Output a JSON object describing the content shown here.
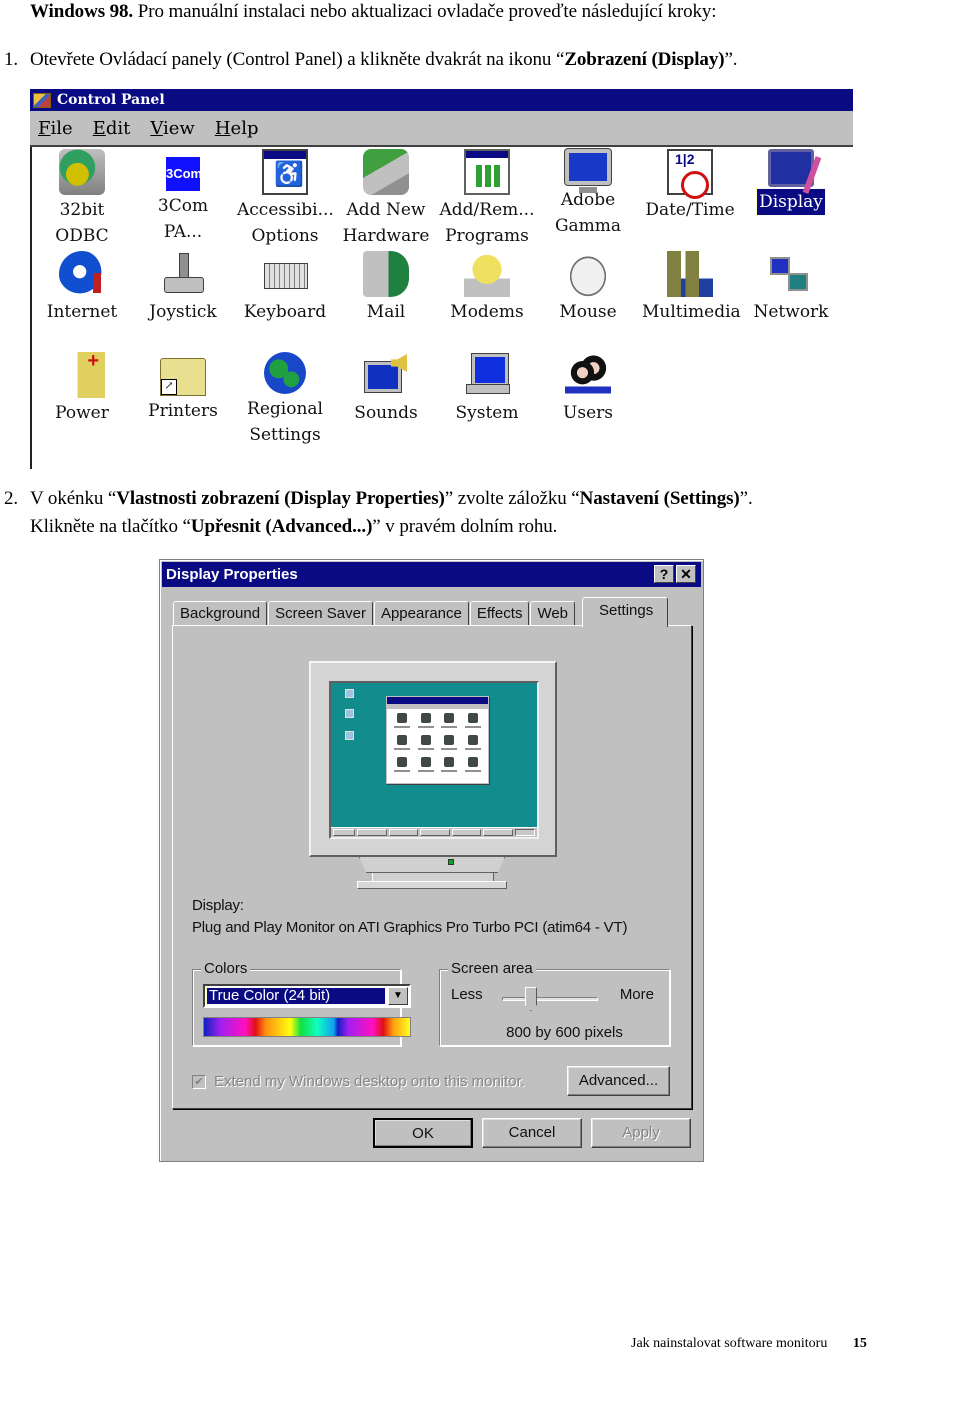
{
  "document": {
    "intro": {
      "bold": "Windows 98.",
      "text": " Pro manuální instalaci nebo aktualizaci ovladače proveďte následující kroky:"
    },
    "step1": {
      "number": "1.",
      "text_before": "Otevřete Ovládací panely (Control Panel) a klikněte dvakrát na ikonu “",
      "bold": "Zobrazení (Display)",
      "text_after": "”."
    },
    "step2": {
      "number": "2.",
      "line1_a": "V okénku “",
      "line1_bold1": "Vlastnosti zobrazení (Display Properties)",
      "line1_b": "” zvolte záložku “",
      "line1_bold2": "Nastavení (Settings)",
      "line1_c": "”.",
      "line2_a": "Klikněte na tlačítko “",
      "line2_bold": "Upřesnit (Advanced...)",
      "line2_b": "” v pravém dolním rohu."
    },
    "footer": {
      "title": "Jak nainstalovat software monitoru",
      "page": "15"
    }
  },
  "control_panel": {
    "title": "Control Panel",
    "menu": [
      {
        "accel": "F",
        "rest": "ile"
      },
      {
        "accel": "E",
        "rest": "dit"
      },
      {
        "accel": "V",
        "rest": "iew"
      },
      {
        "accel": "H",
        "rest": "elp"
      }
    ],
    "items": [
      {
        "line1": "32bit",
        "line2": "ODBC",
        "icon": "odbc-icon"
      },
      {
        "line1": "3Com",
        "line2": "PA...",
        "icon": "3com-icon",
        "icon_text": "3Com"
      },
      {
        "line1": "Accessibi...",
        "line2": "Options",
        "icon": "accessibility-icon"
      },
      {
        "line1": "Add New",
        "line2": "Hardware",
        "icon": "add-hardware-icon"
      },
      {
        "line1": "Add/Rem...",
        "line2": "Programs",
        "icon": "add-remove-programs-icon"
      },
      {
        "line1": "Adobe",
        "line2": "Gamma",
        "icon": "adobe-gamma-icon"
      },
      {
        "line1": "Date/Time",
        "line2": "",
        "icon": "date-time-icon"
      },
      {
        "line1": "Display",
        "line2": "",
        "icon": "display-icon",
        "selected": true
      },
      {
        "line1": "Internet",
        "line2": "",
        "icon": "internet-icon"
      },
      {
        "line1": "Joystick",
        "line2": "",
        "icon": "joystick-icon"
      },
      {
        "line1": "Keyboard",
        "line2": "",
        "icon": "keyboard-icon"
      },
      {
        "line1": "Mail",
        "line2": "",
        "icon": "mail-icon"
      },
      {
        "line1": "Modems",
        "line2": "",
        "icon": "modems-icon"
      },
      {
        "line1": "Mouse",
        "line2": "",
        "icon": "mouse-icon"
      },
      {
        "line1": "Multimedia",
        "line2": "",
        "icon": "multimedia-icon"
      },
      {
        "line1": "Network",
        "line2": "",
        "icon": "network-icon"
      },
      {
        "line1": "Power",
        "line2": "",
        "icon": "power-icon"
      },
      {
        "line1": "Printers",
        "line2": "",
        "icon": "printers-icon"
      },
      {
        "line1": "Regional",
        "line2": "Settings",
        "icon": "regional-settings-icon"
      },
      {
        "line1": "Sounds",
        "line2": "",
        "icon": "sounds-icon"
      },
      {
        "line1": "System",
        "line2": "",
        "icon": "system-icon"
      },
      {
        "line1": "Users",
        "line2": "",
        "icon": "users-icon"
      }
    ]
  },
  "display_properties": {
    "title": "Display Properties",
    "help_button": "?",
    "close_button": "✕",
    "tabs": [
      {
        "label": "Background"
      },
      {
        "label": "Screen Saver"
      },
      {
        "label": "Appearance"
      },
      {
        "label": "Effects"
      },
      {
        "label": "Web"
      },
      {
        "label": "Settings",
        "active": true
      }
    ],
    "display_label": "Display:",
    "display_value": "Plug and Play Monitor on ATI Graphics Pro Turbo PCI (atim64 - VT)",
    "colors": {
      "legend": "Colors",
      "selected": "True Color (24 bit)",
      "arrow": "▼"
    },
    "screen_area": {
      "legend": "Screen area",
      "less": "Less",
      "more": "More",
      "slider_fraction": 0.3,
      "value": "800 by 600 pixels"
    },
    "extend_checkbox": {
      "label": "Extend my Windows desktop onto this monitor.",
      "checked": true,
      "disabled": true,
      "mark": "✔"
    },
    "buttons": {
      "advanced": "Advanced...",
      "ok": "OK",
      "cancel": "Cancel",
      "apply": "Apply"
    }
  }
}
